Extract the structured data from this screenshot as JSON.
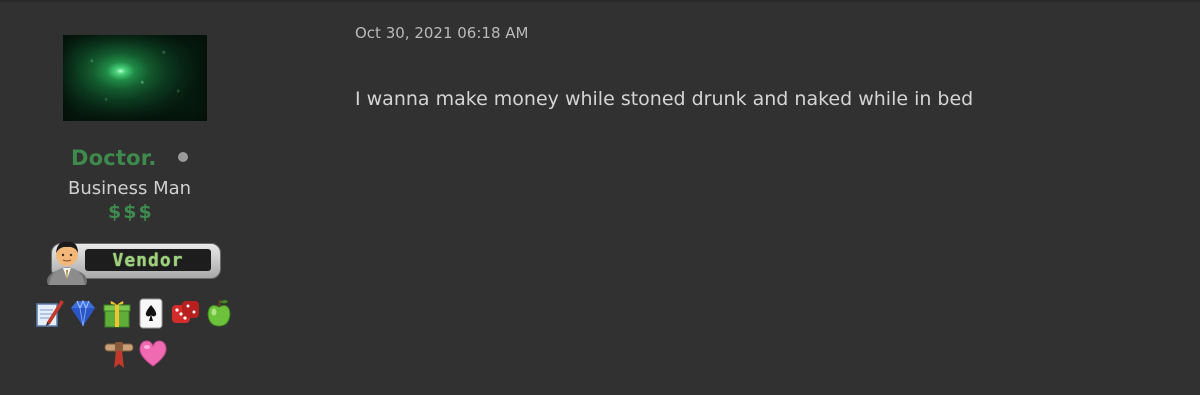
{
  "user": {
    "username": "Doctor.",
    "title": "Business Man",
    "rank": "$$$",
    "badge_label": "Vendor"
  },
  "post": {
    "date": "Oct 30, 2021 06:18 AM",
    "body": "I wanna make money while stoned drunk and naked while in bed"
  },
  "awards": {
    "row1": [
      "writing-award-icon",
      "diamond-award-icon",
      "gift-award-icon",
      "ace-of-spades-award-icon",
      "dice-award-icon",
      "green-apple-award-icon"
    ],
    "row2": [
      "pink-ribbon-award-icon",
      "pink-heart-award-icon"
    ]
  },
  "colors": {
    "background": "#313131",
    "username": "#3d8a4c",
    "rank": "#3f8a4e",
    "post_text": "#d4d4d4",
    "date_text": "#b9b9b9"
  }
}
